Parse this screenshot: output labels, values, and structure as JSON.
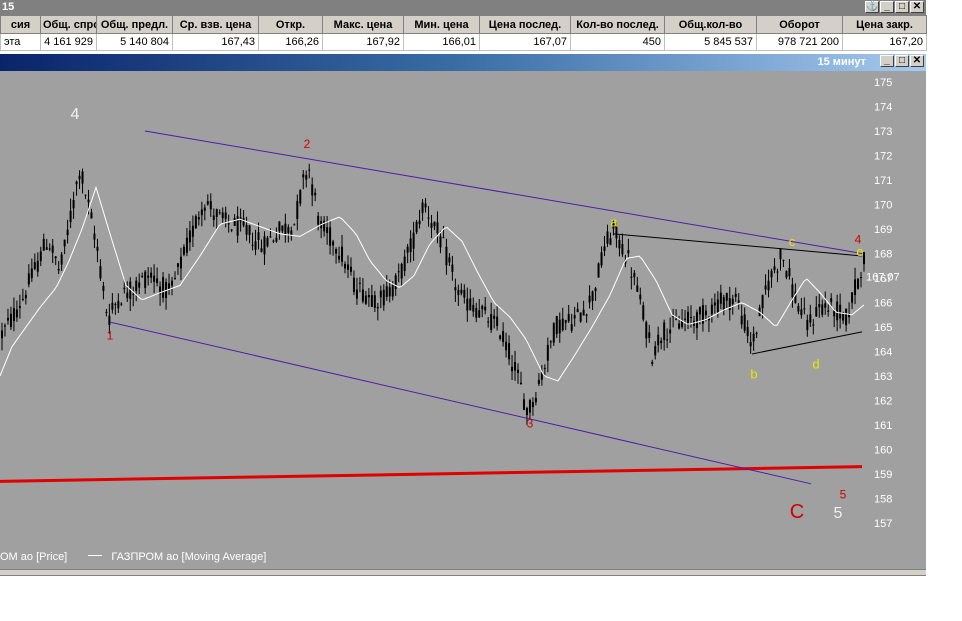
{
  "top_window": {
    "title": "15",
    "buttons": [
      "⚓",
      "_",
      "□",
      "✕"
    ]
  },
  "quote_table": {
    "headers": [
      "сия",
      "Общ. спрос",
      "Общ. предл.",
      "Ср. взв. цена",
      "Откр.",
      "Макс. цена",
      "Мин. цена",
      "Цена послед.",
      "Кол-во послед.",
      "Общ.кол-во",
      "Оборот",
      "Цена закр."
    ],
    "row": [
      "эта",
      "4 161 929",
      "5 140 804",
      "167,43",
      "166,26",
      "167,92",
      "166,01",
      "167,07",
      "450",
      "5 845 537",
      "978 721 200",
      "167,20"
    ]
  },
  "chart_window": {
    "title": "15 минут",
    "buttons": [
      "_",
      "□",
      "✕"
    ]
  },
  "legend": {
    "price": "ОМ ао [Price]",
    "ma": "ГАЗПРОМ ао [Moving Average]"
  },
  "colors": {
    "bg": "#a0a0a0",
    "candle": "#000000",
    "ma": "#ffffff",
    "channel": "#4b1fa8",
    "support": "#e00000",
    "triangle": "#000000",
    "wave_red": "#d40000",
    "wave_yellow": "#e8e800",
    "wave_white": "#f2f2f2"
  },
  "chart_data": {
    "type": "candlestick",
    "y_ticks": [
      175,
      174,
      173,
      172,
      171,
      170,
      169,
      168,
      167,
      166,
      165,
      164,
      163,
      162,
      161,
      160,
      159,
      158,
      157
    ],
    "ylim": [
      156.5,
      175.5
    ],
    "last_price_label": "167,07",
    "last_price": 167.07,
    "bar_count": 290,
    "path_keypoints": [
      [
        0,
        164.6
      ],
      [
        10,
        165.2
      ],
      [
        24,
        166.3
      ],
      [
        48,
        168.6
      ],
      [
        60,
        167.2
      ],
      [
        80,
        171.5
      ],
      [
        96,
        168.5
      ],
      [
        108,
        165.3
      ],
      [
        118,
        166.2
      ],
      [
        134,
        166.6
      ],
      [
        150,
        167.2
      ],
      [
        170,
        166.3
      ],
      [
        188,
        168.4
      ],
      [
        204,
        170.2
      ],
      [
        222,
        169.3
      ],
      [
        244,
        169.0
      ],
      [
        262,
        168.3
      ],
      [
        278,
        168.9
      ],
      [
        294,
        169.2
      ],
      [
        308,
        171.7
      ],
      [
        320,
        169.1
      ],
      [
        338,
        168.3
      ],
      [
        356,
        166.6
      ],
      [
        380,
        166.1
      ],
      [
        398,
        166.9
      ],
      [
        412,
        168.4
      ],
      [
        424,
        170.1
      ],
      [
        442,
        168.4
      ],
      [
        460,
        166.2
      ],
      [
        478,
        165.7
      ],
      [
        500,
        164.9
      ],
      [
        516,
        163.2
      ],
      [
        528,
        161.5
      ],
      [
        540,
        162.8
      ],
      [
        556,
        165.1
      ],
      [
        576,
        165.3
      ],
      [
        592,
        166.2
      ],
      [
        606,
        168.4
      ],
      [
        614,
        168.9
      ],
      [
        628,
        167.8
      ],
      [
        640,
        166.1
      ],
      [
        652,
        163.9
      ],
      [
        662,
        164.8
      ],
      [
        682,
        165.2
      ],
      [
        700,
        165.4
      ],
      [
        718,
        166.0
      ],
      [
        736,
        166.2
      ],
      [
        752,
        164.2
      ],
      [
        768,
        166.8
      ],
      [
        782,
        168.0
      ],
      [
        796,
        166.1
      ],
      [
        808,
        165.0
      ],
      [
        820,
        165.9
      ],
      [
        836,
        165.7
      ],
      [
        846,
        165.3
      ],
      [
        860,
        167.2
      ],
      [
        864,
        167.9
      ]
    ],
    "ma_keypoints": [
      [
        0,
        163.0
      ],
      [
        12,
        164.2
      ],
      [
        26,
        165.0
      ],
      [
        40,
        165.8
      ],
      [
        56,
        166.6
      ],
      [
        68,
        167.6
      ],
      [
        82,
        169.0
      ],
      [
        96,
        170.7
      ],
      [
        110,
        168.8
      ],
      [
        126,
        166.7
      ],
      [
        142,
        166.1
      ],
      [
        160,
        166.4
      ],
      [
        180,
        166.7
      ],
      [
        200,
        167.9
      ],
      [
        220,
        169.2
      ],
      [
        240,
        169.4
      ],
      [
        260,
        169.1
      ],
      [
        280,
        168.8
      ],
      [
        300,
        168.7
      ],
      [
        322,
        169.2
      ],
      [
        340,
        169.5
      ],
      [
        356,
        168.8
      ],
      [
        370,
        167.7
      ],
      [
        386,
        166.9
      ],
      [
        400,
        166.6
      ],
      [
        414,
        167.1
      ],
      [
        430,
        168.4
      ],
      [
        446,
        169.1
      ],
      [
        462,
        168.5
      ],
      [
        478,
        167.2
      ],
      [
        494,
        166.0
      ],
      [
        510,
        165.4
      ],
      [
        526,
        164.5
      ],
      [
        544,
        163.0
      ],
      [
        558,
        162.8
      ],
      [
        574,
        163.8
      ],
      [
        592,
        165.0
      ],
      [
        610,
        166.3
      ],
      [
        626,
        167.8
      ],
      [
        640,
        167.9
      ],
      [
        656,
        166.9
      ],
      [
        672,
        165.5
      ],
      [
        688,
        165.1
      ],
      [
        706,
        165.3
      ],
      [
        724,
        165.7
      ],
      [
        742,
        166.0
      ],
      [
        760,
        165.6
      ],
      [
        776,
        165.0
      ],
      [
        792,
        166.1
      ],
      [
        806,
        167.0
      ],
      [
        820,
        166.4
      ],
      [
        836,
        165.6
      ],
      [
        852,
        165.5
      ],
      [
        864,
        165.9
      ]
    ],
    "lines": [
      {
        "name": "channel-top",
        "x1": 145,
        "y1": 173.0,
        "x2": 862,
        "y2": 168.0,
        "color": "#4b1fa8",
        "width": 1
      },
      {
        "name": "channel-bottom",
        "x1": 110,
        "y1": 165.2,
        "x2": 811,
        "y2": 158.6,
        "color": "#4b1fa8",
        "width": 1
      },
      {
        "name": "support-line",
        "x1": 0,
        "y1": 158.7,
        "x2": 862,
        "y2": 159.3,
        "color": "#e00000",
        "width": 3
      },
      {
        "name": "triangle-top",
        "x1": 614,
        "y1": 168.8,
        "x2": 862,
        "y2": 167.9,
        "color": "#000000",
        "width": 1
      },
      {
        "name": "triangle-bottom",
        "x1": 752,
        "y1": 163.9,
        "x2": 862,
        "y2": 164.8,
        "color": "#000000",
        "width": 1
      }
    ],
    "annotations": [
      {
        "text": "4",
        "x": 75,
        "y": 173.5,
        "color": "#f2f2f2",
        "size": 16
      },
      {
        "text": "1",
        "x": 110,
        "y": 164.5,
        "color": "#d40000",
        "size": 12
      },
      {
        "text": "2",
        "x": 307,
        "y": 172.3,
        "color": "#d40000",
        "size": 12
      },
      {
        "text": "3",
        "x": 530,
        "y": 160.9,
        "color": "#d40000",
        "size": 12
      },
      {
        "text": "a",
        "x": 614,
        "y": 169.1,
        "color": "#e8e800",
        "size": 13
      },
      {
        "text": "b",
        "x": 754,
        "y": 162.9,
        "color": "#e8e800",
        "size": 13
      },
      {
        "text": "c",
        "x": 792,
        "y": 168.3,
        "color": "#e8e800",
        "size": 13
      },
      {
        "text": "d",
        "x": 816,
        "y": 163.3,
        "color": "#e8e800",
        "size": 13
      },
      {
        "text": "4",
        "x": 858,
        "y": 168.4,
        "color": "#d40000",
        "size": 12
      },
      {
        "text": "e",
        "x": 860,
        "y": 167.9,
        "color": "#e8e800",
        "size": 13
      },
      {
        "text": "5",
        "x": 843,
        "y": 158.0,
        "color": "#d40000",
        "size": 12
      },
      {
        "text": "C",
        "x": 797,
        "y": 157.2,
        "color": "#d40000",
        "size": 20
      },
      {
        "text": "5",
        "x": 838,
        "y": 157.2,
        "color": "#f2f2f2",
        "size": 16
      }
    ]
  }
}
